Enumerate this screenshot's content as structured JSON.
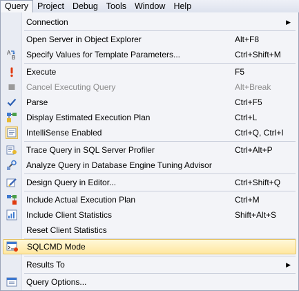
{
  "menubar": {
    "items": [
      "Query",
      "Project",
      "Debug",
      "Tools",
      "Window",
      "Help"
    ]
  },
  "menu": {
    "items": [
      {
        "label": "Connection",
        "shortcut": "",
        "submenu": true,
        "icon": "none"
      },
      {
        "label": "Open Server in Object Explorer",
        "shortcut": "Alt+F8",
        "icon": "none"
      },
      {
        "label": "Specify Values for Template Parameters...",
        "shortcut": "Ctrl+Shift+M",
        "icon": "template-params-icon"
      },
      {
        "label": "Execute",
        "shortcut": "F5",
        "icon": "execute-icon"
      },
      {
        "label": "Cancel Executing Query",
        "shortcut": "Alt+Break",
        "icon": "cancel-icon",
        "disabled": true
      },
      {
        "label": "Parse",
        "shortcut": "Ctrl+F5",
        "icon": "parse-check-icon"
      },
      {
        "label": "Display Estimated Execution Plan",
        "shortcut": "Ctrl+L",
        "icon": "execution-plan-icon"
      },
      {
        "label": "IntelliSense Enabled",
        "shortcut": "Ctrl+Q, Ctrl+I",
        "icon": "intellisense-icon"
      },
      {
        "label": "Trace Query in SQL Server Profiler",
        "shortcut": "Ctrl+Alt+P",
        "icon": "profiler-icon"
      },
      {
        "label": "Analyze Query in Database Engine Tuning Advisor",
        "shortcut": "",
        "icon": "tuning-advisor-icon"
      },
      {
        "label": "Design Query in Editor...",
        "shortcut": "Ctrl+Shift+Q",
        "icon": "design-query-icon"
      },
      {
        "label": "Include Actual Execution Plan",
        "shortcut": "Ctrl+M",
        "icon": "actual-plan-icon"
      },
      {
        "label": "Include Client Statistics",
        "shortcut": "Shift+Alt+S",
        "icon": "client-stats-icon"
      },
      {
        "label": "Reset Client Statistics",
        "shortcut": "",
        "icon": "none"
      },
      {
        "label": "SQLCMD Mode",
        "shortcut": "",
        "icon": "sqlcmd-icon",
        "highlighted": true
      },
      {
        "label": "Results To",
        "shortcut": "",
        "submenu": true,
        "icon": "none"
      },
      {
        "label": "Query Options...",
        "shortcut": "",
        "icon": "query-options-icon"
      }
    ]
  },
  "colors": {
    "highlight": "#ffe7a0",
    "menu_bg": "#f3f4f8",
    "disabled_text": "#8d8d8d"
  }
}
